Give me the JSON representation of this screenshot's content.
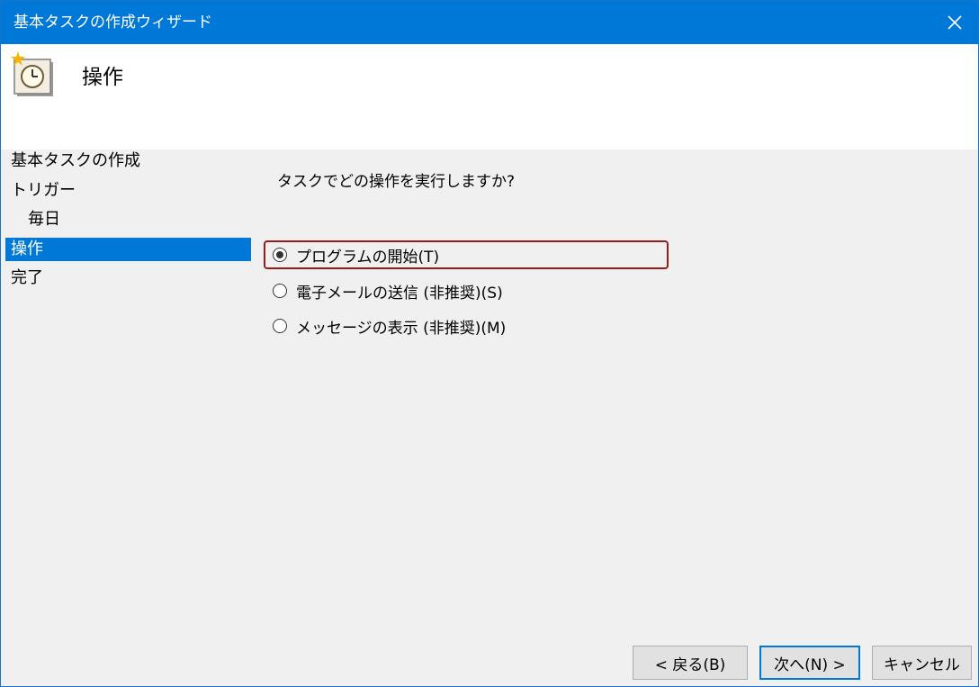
{
  "window": {
    "title": "基本タスクの作成ウィザード"
  },
  "header": {
    "title": "操作",
    "icon": "clock-icon"
  },
  "steps": [
    {
      "label": "基本タスクの作成"
    },
    {
      "label": "トリガー"
    },
    {
      "label": "毎日"
    },
    {
      "label": "操作"
    },
    {
      "label": "完了"
    }
  ],
  "main": {
    "question": "タスクでどの操作を実行しますか?",
    "options": [
      {
        "label": "プログラムの開始(T)",
        "selected": true
      },
      {
        "label": "電子メールの送信 (非推奨)(S)",
        "selected": false
      },
      {
        "label": "メッセージの表示 (非推奨)(M)",
        "selected": false
      }
    ]
  },
  "buttons": {
    "back": "< 戻る(B)",
    "next": "次へ(N) >",
    "cancel": "キャンセル"
  },
  "colors": {
    "accent": "#0078d7",
    "highlight_border": "#9b1a1a"
  }
}
